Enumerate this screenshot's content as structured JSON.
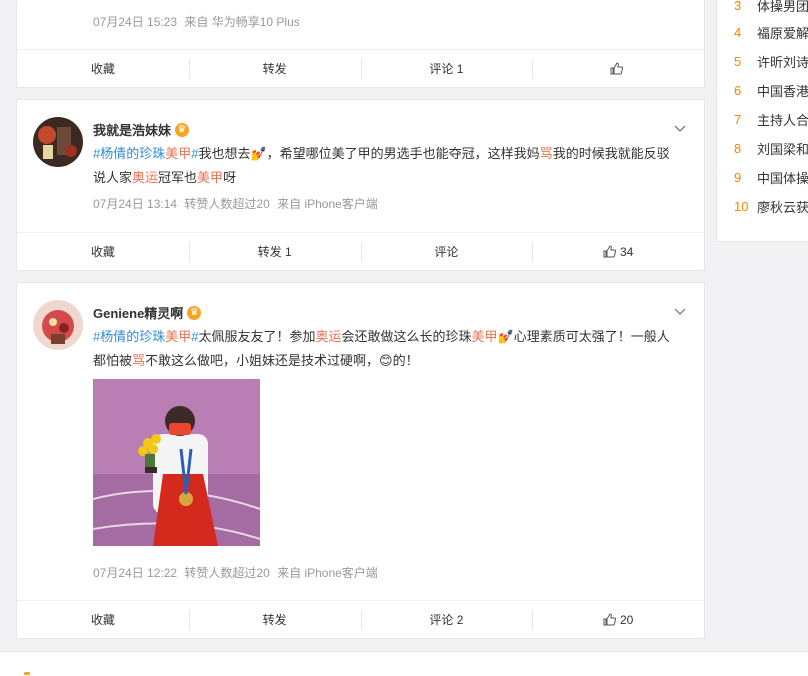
{
  "post1": {
    "meta_time": "07月24日 15:23",
    "meta_source": "来自 华为畅享10 Plus",
    "actions": {
      "save": "收藏",
      "repost": "转发",
      "comment": "评论 1",
      "like": ""
    }
  },
  "post2": {
    "user": "我就是浩妹妹",
    "text_parts": [
      "#杨倩的珍珠",
      "美甲",
      "#",
      "我也想去💅，希望哪位美了甲的男选手也能夺冠，这样我妈",
      "骂",
      "我的时候我就能反驳说人家",
      "奥运",
      "冠军也",
      "美甲",
      "呀"
    ],
    "meta_time": "07月24日 13:14",
    "meta_extra": "转赞人数超过20",
    "meta_source": "来自 iPhone客户端",
    "actions": {
      "save": "收藏",
      "repost": "转发 1",
      "comment": "评论",
      "like": "34"
    }
  },
  "post3": {
    "user": "Geniene精灵啊",
    "text_parts": [
      "#杨倩的珍珠",
      "美甲",
      "#",
      "太佩服友友了！参加",
      "奥运",
      "会还敢做这么长的珍珠",
      "美甲",
      "💅心理素质可太强了！一般人都怕被",
      "骂",
      "不敢这么做吧，小姐妹还是技术过硬啊，😊的！"
    ],
    "meta_time": "07月24日 12:22",
    "meta_extra": "转赞人数超过20",
    "meta_source": "来自 iPhone客户端",
    "actions": {
      "save": "收藏",
      "repost": "转发",
      "comment": "评论 2",
      "like": "20"
    }
  },
  "sidebar": {
    "items": [
      {
        "rank": "3",
        "title": "体操男团"
      },
      {
        "rank": "4",
        "title": "福原爱解"
      },
      {
        "rank": "5",
        "title": "许昕刘诗"
      },
      {
        "rank": "6",
        "title": "中国香港"
      },
      {
        "rank": "7",
        "title": "主持人合"
      },
      {
        "rank": "8",
        "title": "刘国梁和"
      },
      {
        "rank": "9",
        "title": "中国体操"
      },
      {
        "rank": "10",
        "title": "廖秋云获"
      }
    ]
  },
  "colors": {
    "accent": "#eb7350",
    "rank": "#ff8200",
    "link": "#2f8dd6"
  }
}
